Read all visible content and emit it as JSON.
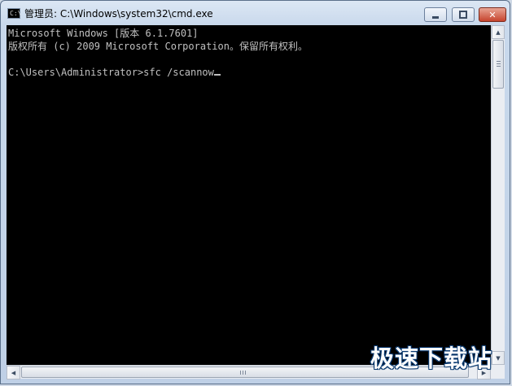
{
  "window": {
    "title": "管理员: C:\\Windows\\system32\\cmd.exe",
    "app_icon_text": "C:\\",
    "minimize_symbol": "",
    "close_symbol": "✕"
  },
  "console": {
    "lines": [
      "Microsoft Windows [版本 6.1.7601]",
      "版权所有 (c) 2009 Microsoft Corporation。保留所有权利。",
      "",
      "C:\\Users\\Administrator>sfc /scannow"
    ]
  },
  "scrollbars": {
    "up_arrow": "▲",
    "down_arrow": "▼",
    "left_arrow": "◀",
    "right_arrow": "▶"
  },
  "watermark": "极速下载站",
  "colors": {
    "console_bg": "#000000",
    "console_text": "#c0c0c0",
    "close_button": "#c7442e"
  }
}
